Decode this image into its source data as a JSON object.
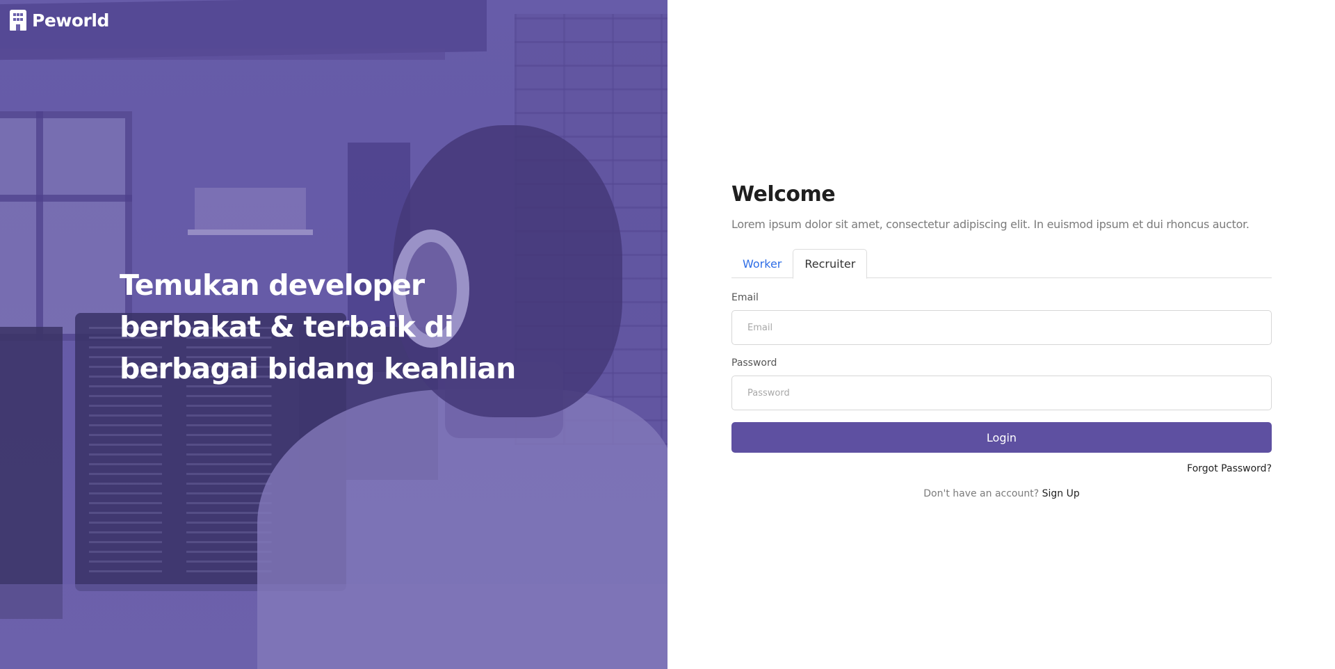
{
  "brand": {
    "name": "Peworld",
    "icon": "building-icon"
  },
  "hero": {
    "headline": "Temukan developer berbakat & terbaik di berbagai bidang keahlian",
    "overlay_color": "#5e50a1"
  },
  "form": {
    "title": "Welcome",
    "subtitle": "Lorem ipsum dolor sit amet, consectetur adipiscing elit. In euismod ipsum et dui rhoncus auctor.",
    "tabs": [
      {
        "label": "Worker",
        "active": false
      },
      {
        "label": "Recruiter",
        "active": true
      }
    ],
    "email": {
      "label": "Email",
      "placeholder": "Email",
      "value": ""
    },
    "password": {
      "label": "Password",
      "placeholder": "Password",
      "value": ""
    },
    "login_label": "Login",
    "forgot_label": "Forgot Password?",
    "signup_prompt": "Don't have an account?",
    "signup_label": "Sign Up"
  },
  "colors": {
    "primary": "#5e50a1",
    "tab_link": "#2e6de6",
    "text_dark": "#1f1f1f",
    "text_muted": "#7b7b7b"
  }
}
